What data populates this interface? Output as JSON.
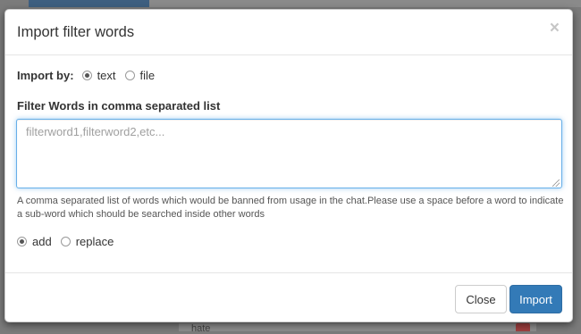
{
  "modal": {
    "title": "Import filter words",
    "close_symbol": "×"
  },
  "import_by": {
    "label": "Import by:",
    "options": [
      {
        "label": "text",
        "selected": true
      },
      {
        "label": "file",
        "selected": false
      }
    ]
  },
  "filter_words": {
    "label": "Filter Words in comma separated list",
    "value": "",
    "placeholder": "filterword1,filterword2,etc...",
    "help": "A comma separated list of words which would be banned from usage in the chat.Please use a space before a word to indicate a sub-word which should be searched inside other words"
  },
  "mode": {
    "options": [
      {
        "label": "add",
        "selected": true
      },
      {
        "label": "replace",
        "selected": false
      }
    ]
  },
  "footer": {
    "close_label": "Close",
    "import_label": "Import"
  },
  "background": {
    "row_text": "hate"
  },
  "colors": {
    "primary": "#337ab7",
    "focus_border": "#66afe9"
  },
  "icons": {
    "close": "close-icon",
    "delete": "trash-icon"
  }
}
